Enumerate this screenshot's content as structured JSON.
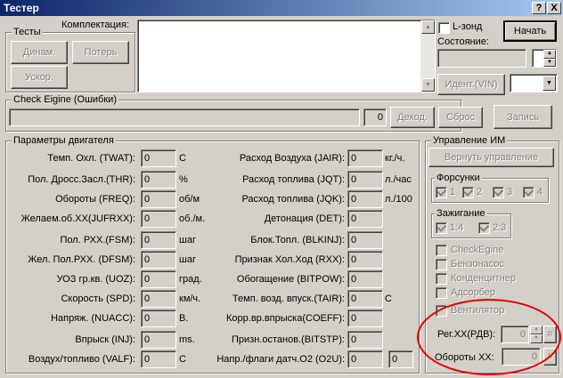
{
  "window": {
    "title": "Тестер",
    "help": "?",
    "close": "X"
  },
  "tests": {
    "label": "Тесты",
    "dinam": "Динам.",
    "poter": "Потерь",
    "uskor": "Ускор."
  },
  "komplektacia": {
    "label": "Комплектация:"
  },
  "lzond": {
    "label": "L-зонд"
  },
  "start": {
    "label": "Начать"
  },
  "state": {
    "label": "Состояние:"
  },
  "ident": {
    "label": "Идент.(VIN)"
  },
  "check": {
    "label": "Check Eigine (Ошибки)",
    "count": "0",
    "decode": "Декод.",
    "reset": "Сброс"
  },
  "write": {
    "label": "Запись"
  },
  "engine": {
    "label": "Параметры двигателя",
    "left": [
      {
        "name": "Темп. Охл. (TWAT):",
        "value": "0",
        "unit": "C"
      },
      {
        "name": "Пол. Дросс.Засл.(THR):",
        "value": "0",
        "unit": "%"
      },
      {
        "name": "Обороты (FREQ):",
        "value": "0",
        "unit": "об/м"
      },
      {
        "name": "Желаем.об.ХХ(JUFRXX):",
        "value": "0",
        "unit": "об./м."
      },
      {
        "name": "Пол. РХХ.(FSM):",
        "value": "0",
        "unit": "шаг"
      },
      {
        "name": "Жел. Пол.РХХ. (DFSM):",
        "value": "0",
        "unit": "шаг"
      },
      {
        "name": "УОЗ гр.кв. (UOZ):",
        "value": "0",
        "unit": "град."
      },
      {
        "name": "Скорость (SPD):",
        "value": "0",
        "unit": "км/ч."
      },
      {
        "name": "Напряж. (NUACC):",
        "value": "0",
        "unit": "В."
      },
      {
        "name": "Впрыск (INJ):",
        "value": "0",
        "unit": "ms."
      },
      {
        "name": "Воздух/топливо (VALF):",
        "value": "0",
        "unit": "C"
      }
    ],
    "right": [
      {
        "name": "Расход Воздуха (JAIR):",
        "value": "0",
        "unit": "кг./ч."
      },
      {
        "name": "Расход топлива (JQT):",
        "value": "0",
        "unit": "л./час"
      },
      {
        "name": "Расход топлива (JQK):",
        "value": "0",
        "unit": "л./100"
      },
      {
        "name": "Детонация (DET):",
        "value": "0",
        "unit": ""
      },
      {
        "name": "Блок.Топл. (BLKINJ):",
        "value": "0",
        "unit": ""
      },
      {
        "name": "Признак Хол.Ход (RXX):",
        "value": "0",
        "unit": ""
      },
      {
        "name": "Обогащение (BITPOW):",
        "value": "0",
        "unit": ""
      },
      {
        "name": "Темп. возд. впуск.(TAIR):",
        "value": "0",
        "unit": "C"
      },
      {
        "name": "Корр.вр.впрыска(COEFF):",
        "value": "0",
        "unit": ""
      },
      {
        "name": "Призн.останов.(BITSTP):",
        "value": "0",
        "unit": ""
      },
      {
        "name": "Напр./флаги датч.O2 (O2U):",
        "value": "0",
        "unit": "",
        "extra": "0"
      }
    ]
  },
  "control": {
    "label": "Управление ИМ",
    "return": "Вернуть управление",
    "injectors": {
      "label": "Форсунки",
      "items": [
        "1",
        "2",
        "3",
        "4"
      ]
    },
    "ignition": {
      "label": "Зажигание",
      "items": [
        "1:4",
        "2:3"
      ]
    },
    "checks": [
      "CheckEgine",
      "Бензонасос",
      "Конденцитнер",
      "Адсорбер",
      "Вентилятор"
    ],
    "regxx": {
      "label": "Рег.ХХ(РДВ):",
      "value": "0",
      "hash": "#"
    },
    "oboroty": {
      "label": "Обороты ХХ:",
      "value": "0",
      "hash": "#"
    }
  },
  "colors": {
    "highlight": "#e00000",
    "titlebar": "#0a246a"
  }
}
